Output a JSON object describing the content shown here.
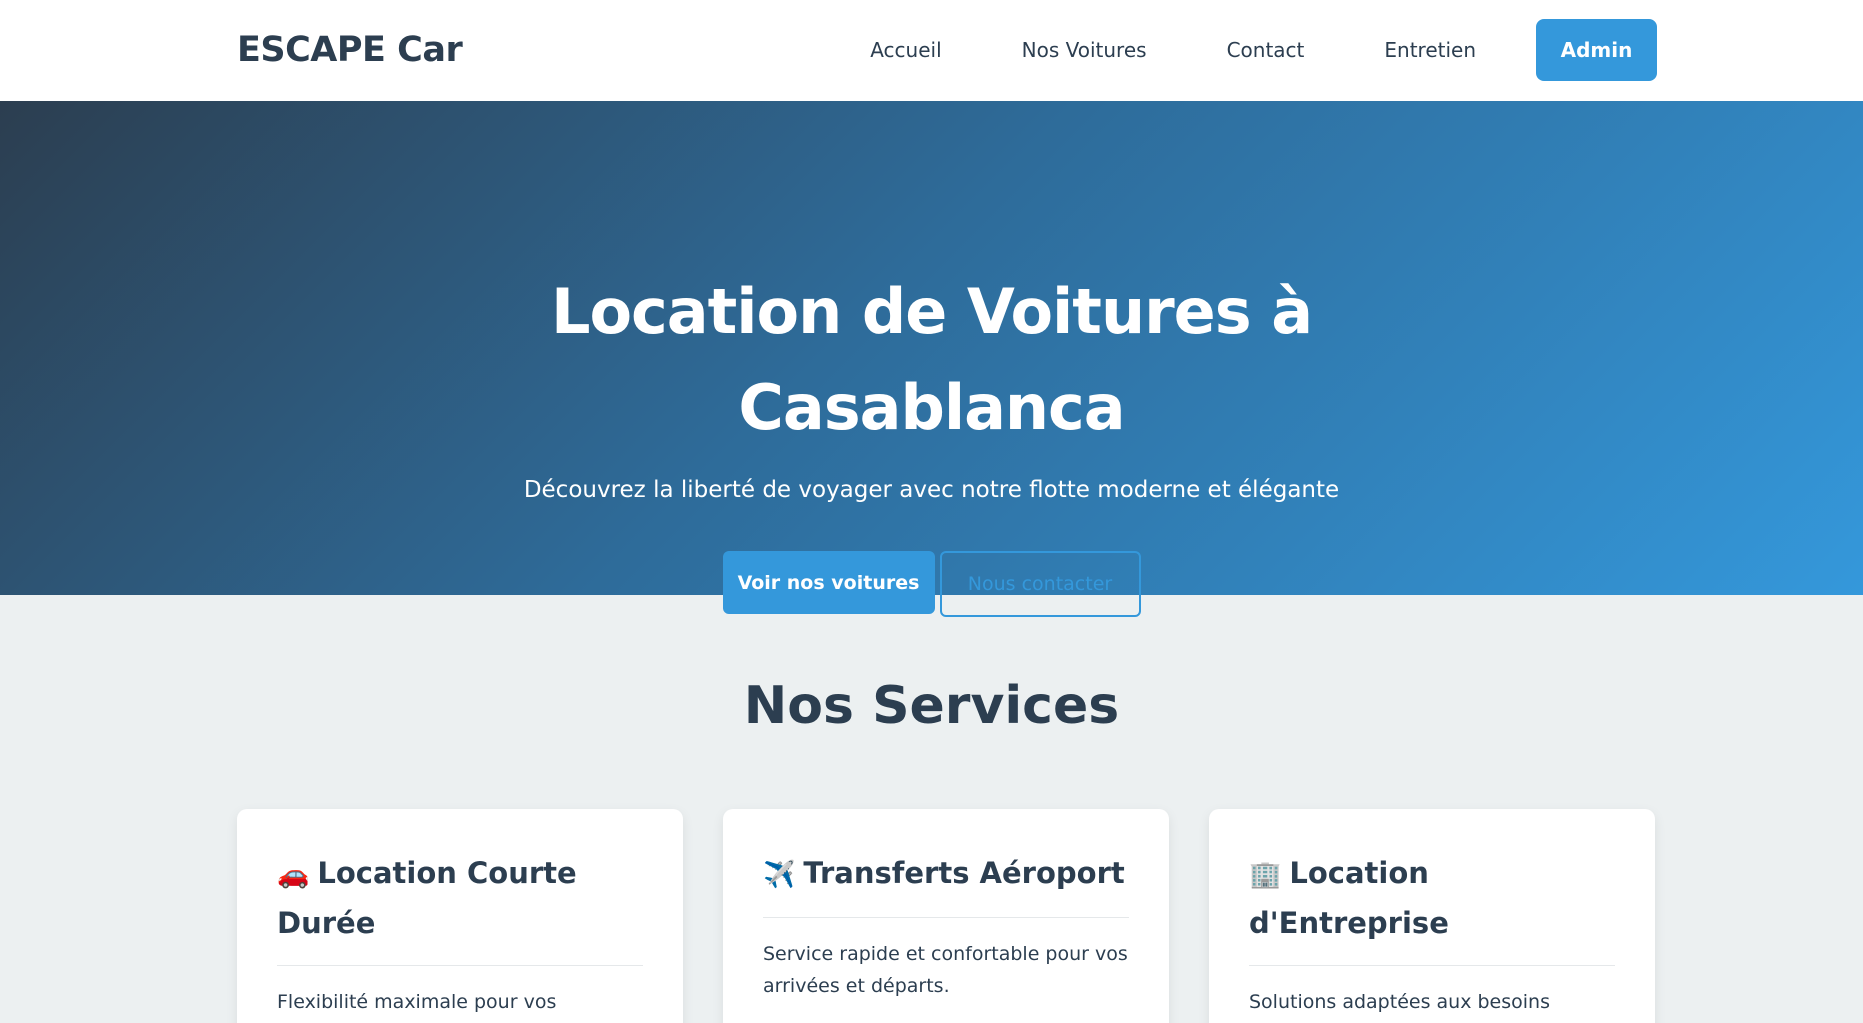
{
  "nav": {
    "logo": "ESCAPE Car",
    "links": [
      "Accueil",
      "Nos Voitures",
      "Contact",
      "Entretien"
    ],
    "admin_label": "Admin"
  },
  "hero": {
    "title": "Location de Voitures à Casablanca",
    "subtitle": "Découvrez la liberté de voyager avec notre flotte moderne et élégante",
    "primary_button": "Voir nos voitures",
    "secondary_button": "Nous contacter"
  },
  "services": {
    "title": "Nos Services",
    "cards": [
      {
        "icon": "🚗",
        "icon_name": "car-icon",
        "title": "Location Courte Durée",
        "text": "Flexibilité maximale pour vos"
      },
      {
        "icon": "✈️",
        "icon_name": "airplane-icon",
        "title": "Transferts Aéroport",
        "text": "Service rapide et confortable pour vos arrivées et départs."
      },
      {
        "icon": "🏢",
        "icon_name": "office-building-icon",
        "title": "Location d'Entreprise",
        "text": "Solutions adaptées aux besoins professionnels de votre entreprise."
      }
    ]
  },
  "colors": {
    "primary": "#3498db",
    "dark": "#2c3e50",
    "background": "#ecf0f1"
  }
}
